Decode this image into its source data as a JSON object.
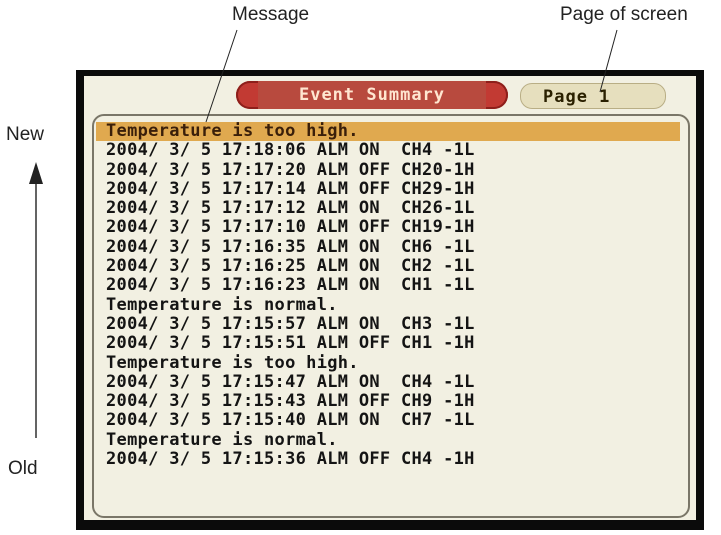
{
  "annotations": {
    "message_label": "Message",
    "page_label": "Page of screen",
    "new_label": "New",
    "old_label": "Old"
  },
  "screen": {
    "title": "Event Summary",
    "page_text": "Page 1",
    "events": [
      {
        "text": "Temperature is too high.",
        "type": "message",
        "selected": true
      },
      {
        "text": "2004/ 3/ 5 17:18:06 ALM ON  CH4 -1L",
        "type": "alarm"
      },
      {
        "text": "2004/ 3/ 5 17:17:20 ALM OFF CH20-1H",
        "type": "alarm"
      },
      {
        "text": "2004/ 3/ 5 17:17:14 ALM OFF CH29-1H",
        "type": "alarm"
      },
      {
        "text": "2004/ 3/ 5 17:17:12 ALM ON  CH26-1L",
        "type": "alarm"
      },
      {
        "text": "2004/ 3/ 5 17:17:10 ALM OFF CH19-1H",
        "type": "alarm"
      },
      {
        "text": "2004/ 3/ 5 17:16:35 ALM ON  CH6 -1L",
        "type": "alarm"
      },
      {
        "text": "2004/ 3/ 5 17:16:25 ALM ON  CH2 -1L",
        "type": "alarm"
      },
      {
        "text": "2004/ 3/ 5 17:16:23 ALM ON  CH1 -1L",
        "type": "alarm"
      },
      {
        "text": "Temperature is normal.",
        "type": "message"
      },
      {
        "text": "2004/ 3/ 5 17:15:57 ALM ON  CH3 -1L",
        "type": "alarm"
      },
      {
        "text": "2004/ 3/ 5 17:15:51 ALM OFF CH1 -1H",
        "type": "alarm"
      },
      {
        "text": "Temperature is too high.",
        "type": "message"
      },
      {
        "text": "2004/ 3/ 5 17:15:47 ALM ON  CH4 -1L",
        "type": "alarm"
      },
      {
        "text": "2004/ 3/ 5 17:15:43 ALM OFF CH9 -1H",
        "type": "alarm"
      },
      {
        "text": "2004/ 3/ 5 17:15:40 ALM ON  CH7 -1L",
        "type": "alarm"
      },
      {
        "text": "Temperature is normal.",
        "type": "message"
      },
      {
        "text": "2004/ 3/ 5 17:15:36 ALM OFF CH4 -1H",
        "type": "alarm"
      }
    ]
  },
  "colors": {
    "selected_row": "#e0a94f",
    "title_tab": "#c23a33",
    "screen_background": "#f2f0e2"
  }
}
